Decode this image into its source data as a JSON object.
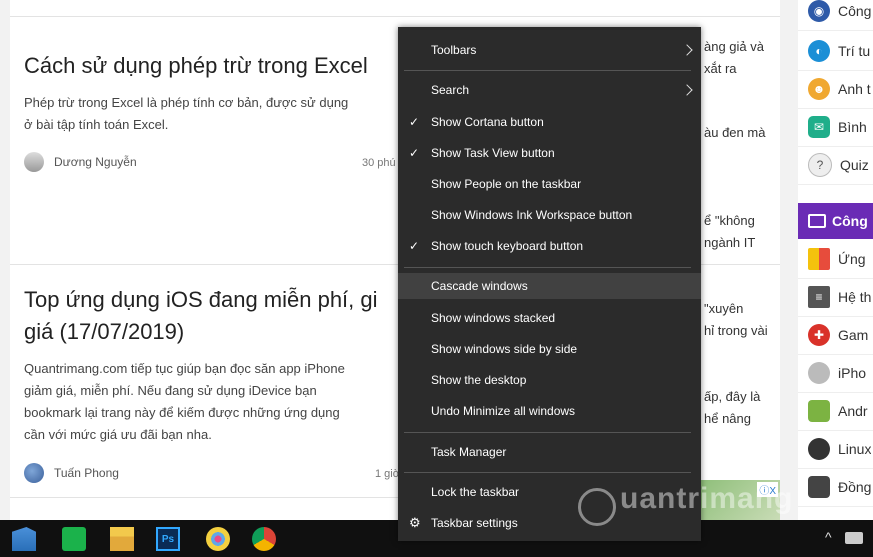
{
  "articles": [
    {
      "title": "Cách sử dụng phép trừ trong Excel",
      "desc_lines": [
        "Phép trừ trong Excel là phép tính cơ bản, được sử dụng",
        "ở bài tập tính toán Excel."
      ],
      "author": "Dương Nguyễn",
      "time": "30 phú"
    },
    {
      "title_lines": [
        "Top ứng dụng iOS đang miễn phí, gi",
        "giá (17/07/2019)"
      ],
      "desc_lines": [
        "Quantrimang.com tiếp tục giúp bạn đọc săn app iPhone",
        "giảm giá, miễn phí. Nếu đang sử dụng iDevice bạn",
        "bookmark lại trang này để kiếm được những ứng dụng",
        "cần với mức giá ưu đãi bạn nha."
      ],
      "author": "Tuấn Phong",
      "time": "1 giờ"
    }
  ],
  "right_snippets": [
    "àng giả và",
    "xắt ra",
    "àu đen mà",
    "ể \"không",
    "ngành IT",
    "\"xuyên",
    "hỉ trong vài",
    "ấp, đây là",
    "hể nâng"
  ],
  "ad": {
    "close": "ⓘX"
  },
  "sidebar": {
    "items_top": [
      {
        "label": "Công",
        "icon": "globe-icon",
        "color": "#2e5aa8"
      },
      {
        "label": "Trí tu",
        "icon": "ai-icon",
        "color": "#1b8fd6"
      },
      {
        "label": "Anh t",
        "icon": "person-icon",
        "color": "#f0a830"
      },
      {
        "label": "Bình",
        "icon": "chat-icon",
        "color": "#1fae8a"
      },
      {
        "label": "Quiz",
        "icon": "question-icon",
        "color": "#bbbbbb"
      }
    ],
    "header": "Công",
    "items_bottom": [
      {
        "label": "Ứng",
        "icon": "apps-icon",
        "color": "#e74c3c"
      },
      {
        "label": "Hệ th",
        "icon": "server-icon",
        "color": "#555555"
      },
      {
        "label": "Gam",
        "icon": "gamepad-icon",
        "color": "#d9322a"
      },
      {
        "label": "iPho",
        "icon": "apple-icon",
        "color": "#999999"
      },
      {
        "label": "Andr",
        "icon": "android-icon",
        "color": "#7cb342"
      },
      {
        "label": "Linux",
        "icon": "linux-icon",
        "color": "#333333"
      },
      {
        "label": "Đồng",
        "icon": "watch-icon",
        "color": "#444444"
      }
    ]
  },
  "context_menu": {
    "items": [
      {
        "label": "Toolbars",
        "checked": false,
        "submenu": true
      },
      {
        "label": "Search",
        "checked": false,
        "submenu": true
      },
      {
        "label": "Show Cortana button",
        "checked": true,
        "submenu": false
      },
      {
        "label": "Show Task View button",
        "checked": true,
        "submenu": false
      },
      {
        "label": "Show People on the taskbar",
        "checked": false,
        "submenu": false
      },
      {
        "label": "Show Windows Ink Workspace button",
        "checked": false,
        "submenu": false
      },
      {
        "label": "Show touch keyboard button",
        "checked": true,
        "submenu": false
      },
      {
        "label": "Cascade windows",
        "checked": false,
        "submenu": false,
        "highlighted": true
      },
      {
        "label": "Show windows stacked",
        "checked": false,
        "submenu": false
      },
      {
        "label": "Show windows side by side",
        "checked": false,
        "submenu": false
      },
      {
        "label": "Show the desktop",
        "checked": false,
        "submenu": false
      },
      {
        "label": "Undo Minimize all windows",
        "checked": false,
        "submenu": false
      },
      {
        "label": "Task Manager",
        "checked": false,
        "submenu": false
      },
      {
        "label": "Lock the taskbar",
        "checked": false,
        "submenu": false
      },
      {
        "label": "Taskbar settings",
        "checked": false,
        "submenu": false,
        "icon": "gear-icon"
      }
    ],
    "check_glyph": "✓"
  },
  "taskbar": {
    "icons": [
      "file-explorer-pin-icon",
      "camtasia-icon",
      "file-explorer-icon",
      "photoshop-icon",
      "paint-icon",
      "chrome-icon"
    ],
    "photoshop_text": "Ps",
    "tray": "^"
  },
  "watermark": "uantrimang"
}
